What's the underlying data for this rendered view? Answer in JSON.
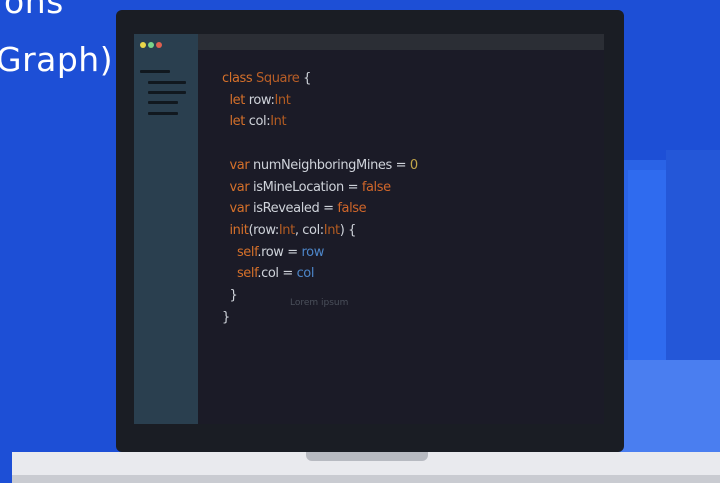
{
  "slide": {
    "title_line_1": "ons",
    "title_line_2": "Graph)"
  },
  "editor": {
    "window_controls": [
      {
        "name": "yellow",
        "color": "#e9d64a"
      },
      {
        "name": "green",
        "color": "#7ad38a"
      },
      {
        "name": "red",
        "color": "#e0604f"
      }
    ],
    "code_lines": [
      "class Square {",
      "  let row:Int",
      "  let col:Int",
      "",
      "  var numNeighboringMines = 0",
      "  var isMineLocation = false",
      "  var isRevealed = false",
      "  init(row:Int, col:Int) {",
      "    self.row = row",
      "    self.col = col",
      "  }",
      "}"
    ],
    "watermark": "Lorem ipsum"
  },
  "colors": {
    "background": "#1d4fd6",
    "keyword": "#d5702a",
    "type": "#b25b22",
    "text": "#cfd3da",
    "parameter": "#4d86c9"
  }
}
